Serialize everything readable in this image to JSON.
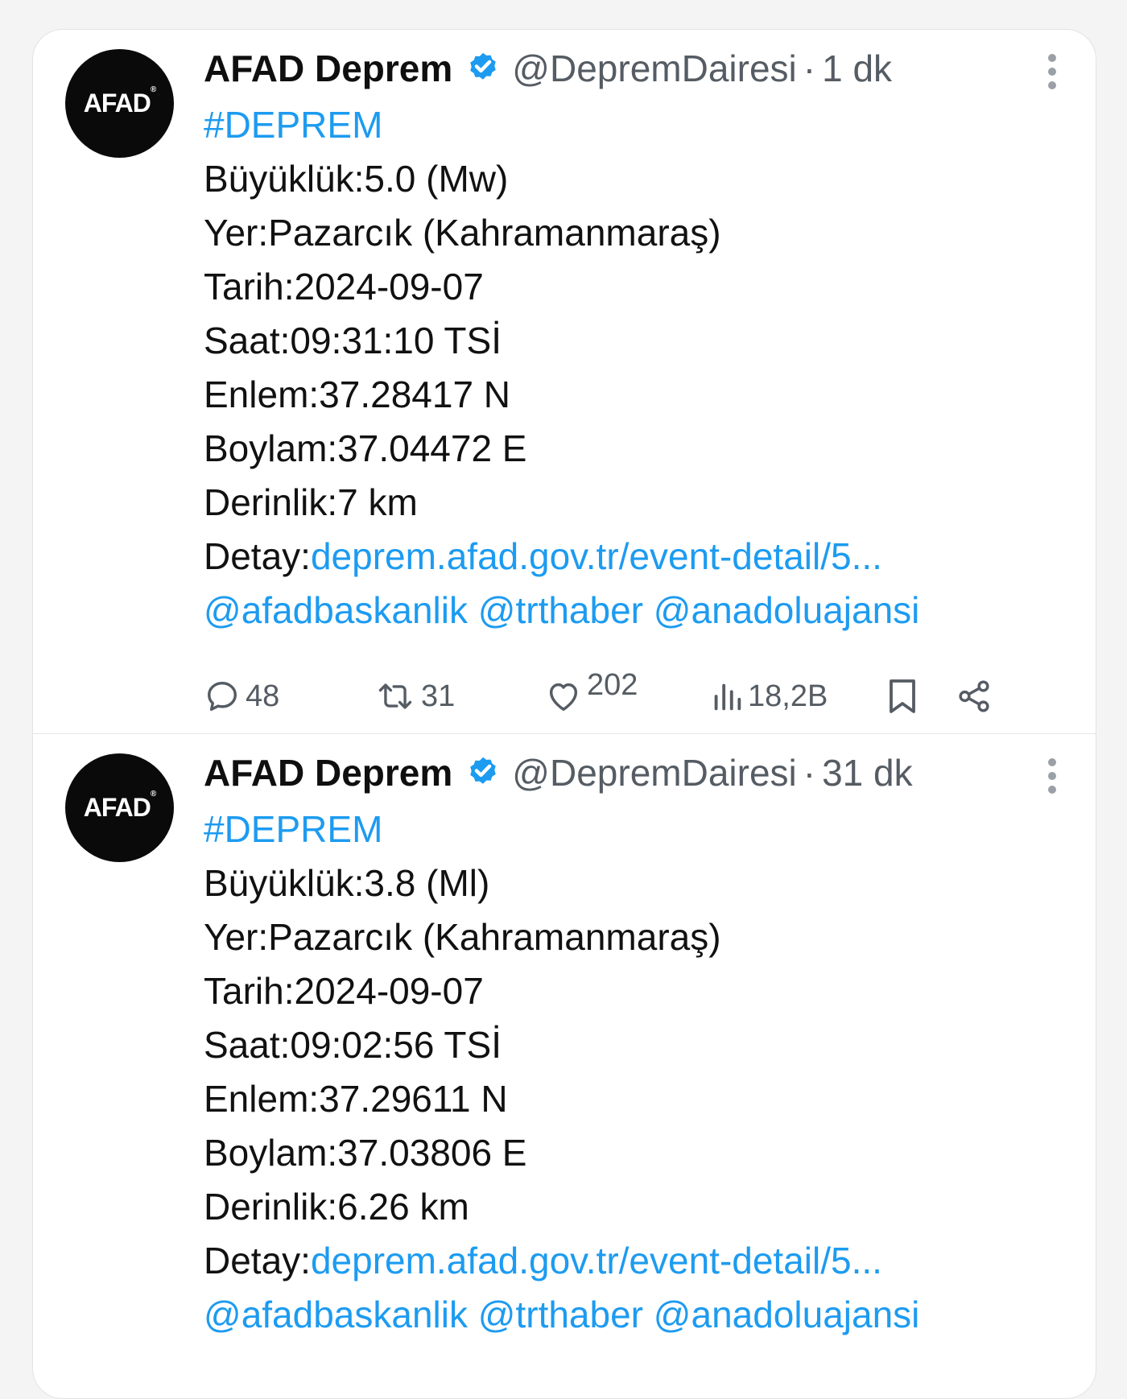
{
  "colors": {
    "link": "#1d9bf0",
    "verified": "#1d9bf0",
    "avatar_bg": "#0a0a0a"
  },
  "tweets": [
    {
      "author": "AFAD Deprem",
      "handle": "@DepremDairesi",
      "separator": "·",
      "time": "1 dk",
      "avatar_text": "AFAD",
      "hashtag": "#DEPREM",
      "lines": [
        "Büyüklük:5.0 (Mw)",
        "Yer:Pazarcık (Kahramanmaraş)",
        "Tarih:2024-09-07",
        "Saat:09:31:10 TSİ",
        "Enlem:37.28417 N",
        "Boylam:37.04472 E",
        "Derinlik:7 km"
      ],
      "detail_label": "Detay:",
      "detail_link": "deprem.afad.gov.tr/event-detail/5...",
      "mentions": "@afadbaskanlik @trthaber @anadoluajansi",
      "stats": {
        "replies": "48",
        "retweets": "31",
        "likes": "202",
        "views": "18,2B"
      },
      "icons": [
        "verified-icon",
        "more-icon",
        "reply-icon",
        "retweet-icon",
        "like-icon",
        "views-icon",
        "bookmark-icon",
        "share-icon"
      ]
    },
    {
      "author": "AFAD Deprem",
      "handle": "@DepremDairesi",
      "separator": "·",
      "time": "31 dk",
      "avatar_text": "AFAD",
      "hashtag": "#DEPREM",
      "lines": [
        "Büyüklük:3.8 (Ml)",
        "Yer:Pazarcık (Kahramanmaraş)",
        "Tarih:2024-09-07",
        "Saat:09:02:56 TSİ",
        "Enlem:37.29611 N",
        "Boylam:37.03806 E",
        "Derinlik:6.26 km"
      ],
      "detail_label": "Detay:",
      "detail_link": "deprem.afad.gov.tr/event-detail/5...",
      "mentions": "@afadbaskanlik @trthaber @anadoluajansi",
      "icons": [
        "verified-icon",
        "more-icon"
      ]
    }
  ]
}
